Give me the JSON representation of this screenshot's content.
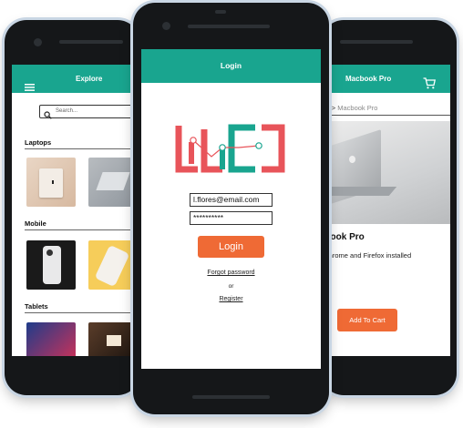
{
  "left_screen": {
    "app_bar": {
      "title": "Explore",
      "menu_icon": "hamburger-menu-icon"
    },
    "search": {
      "placeholder": "Search..."
    },
    "sections": [
      {
        "title": "Laptops"
      },
      {
        "title": "Mobile"
      },
      {
        "title": "Tablets"
      }
    ]
  },
  "center_screen": {
    "app_bar": {
      "title": "Login"
    },
    "email": {
      "value": "l.flores@email.com"
    },
    "password": {
      "value": "**********"
    },
    "login_label": "Login",
    "forgot_password": "Forgot password",
    "or": "or",
    "register": "Register"
  },
  "right_screen": {
    "app_bar": {
      "title": "Macbook Pro",
      "cart_icon": "shopping-cart-icon"
    },
    "breadcrumb": {
      "parent": "Laptops >",
      "current": "Macbook Pro"
    },
    "product": {
      "title": "Macbook Pro",
      "description": "Comes with Chrome and Firefox installed"
    },
    "add_to_cart_label": "Add To Cart"
  },
  "colors": {
    "accent": "#19a58f",
    "button": "#ef6a35",
    "logo_red": "#e8545a",
    "logo_teal": "#19a58f"
  }
}
